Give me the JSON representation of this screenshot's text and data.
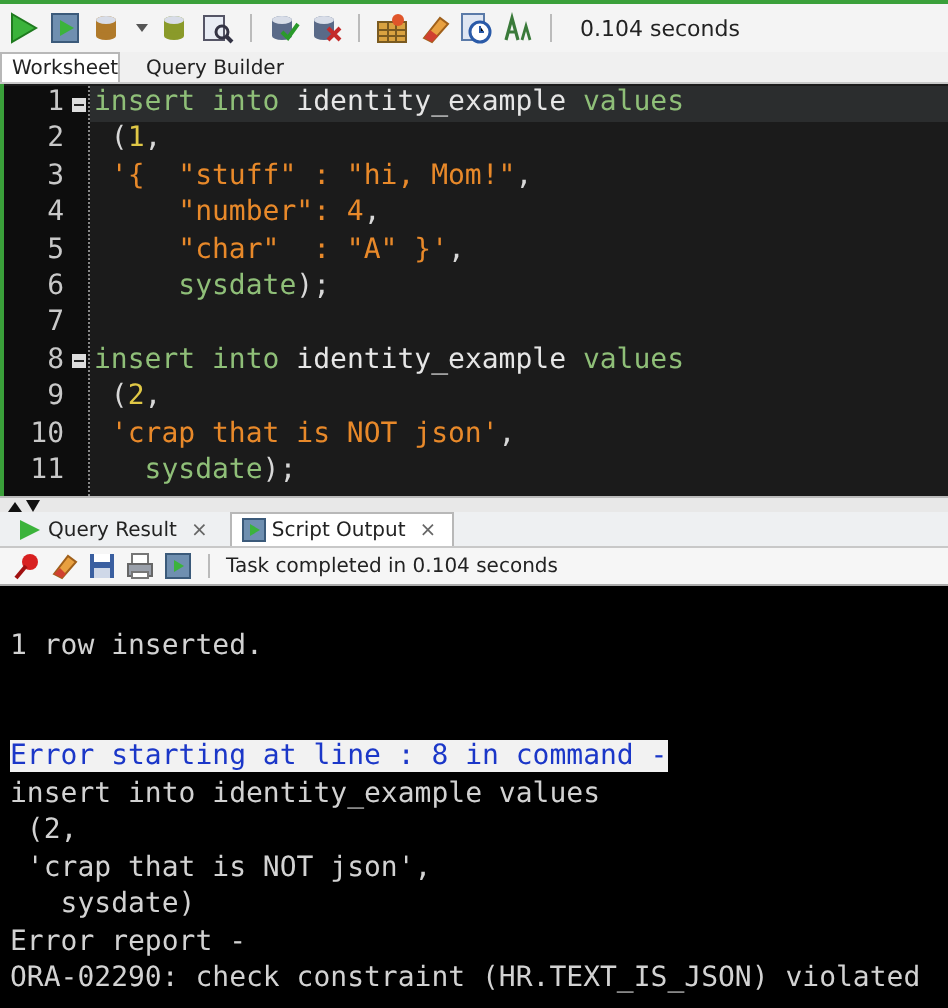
{
  "toolbar": {
    "elapsed": "0.104 seconds"
  },
  "editor_tabs": [
    {
      "label": "Worksheet",
      "selected": true
    },
    {
      "label": "Query Builder",
      "selected": false
    }
  ],
  "editor": {
    "lines": [
      {
        "number": "1",
        "foldable": true,
        "current": true,
        "tokens": [
          {
            "kind": "keyword",
            "text": "insert into "
          },
          {
            "kind": "ident",
            "text": "identity_example "
          },
          {
            "kind": "keyword",
            "text": "values"
          }
        ]
      },
      {
        "number": "2",
        "foldable": false,
        "current": false,
        "tokens": [
          {
            "kind": "punct",
            "text": " ("
          },
          {
            "kind": "number",
            "text": "1"
          },
          {
            "kind": "punct",
            "text": ","
          }
        ]
      },
      {
        "number": "3",
        "foldable": false,
        "current": false,
        "tokens": [
          {
            "kind": "string",
            "text": " '{  \"stuff\" : \"hi, Mom!\""
          },
          {
            "kind": "punct",
            "text": ","
          }
        ]
      },
      {
        "number": "4",
        "foldable": false,
        "current": false,
        "tokens": [
          {
            "kind": "string",
            "text": "     \"number\": 4"
          },
          {
            "kind": "punct",
            "text": ","
          }
        ]
      },
      {
        "number": "5",
        "foldable": false,
        "current": false,
        "tokens": [
          {
            "kind": "string",
            "text": "     \"char\"  : \"A\" }'"
          },
          {
            "kind": "punct",
            "text": ","
          }
        ]
      },
      {
        "number": "6",
        "foldable": false,
        "current": false,
        "tokens": [
          {
            "kind": "keyword",
            "text": "     sysdate"
          },
          {
            "kind": "punct",
            "text": ");"
          }
        ]
      },
      {
        "number": "7",
        "foldable": false,
        "current": false
      },
      {
        "number": "8",
        "foldable": true,
        "current": false,
        "tokens": [
          {
            "kind": "keyword",
            "text": "insert into "
          },
          {
            "kind": "ident",
            "text": "identity_example "
          },
          {
            "kind": "keyword",
            "text": "values"
          }
        ]
      },
      {
        "number": "9",
        "foldable": false,
        "current": false,
        "tokens": [
          {
            "kind": "punct",
            "text": " ("
          },
          {
            "kind": "number",
            "text": "2"
          },
          {
            "kind": "punct",
            "text": ","
          }
        ]
      },
      {
        "number": "10",
        "foldable": false,
        "current": false,
        "tokens": [
          {
            "kind": "string",
            "text": " 'crap that is NOT json'"
          },
          {
            "kind": "punct",
            "text": ","
          }
        ]
      },
      {
        "number": "11",
        "foldable": false,
        "current": false,
        "tokens": [
          {
            "kind": "keyword",
            "text": "   sysdate"
          },
          {
            "kind": "punct",
            "text": ");"
          }
        ]
      }
    ]
  },
  "result_tabs": [
    {
      "label": "Query Result",
      "selected": false,
      "close": "×"
    },
    {
      "label": "Script Output",
      "selected": true,
      "close": "×"
    }
  ],
  "output_toolbar": {
    "status": "Task completed in 0.104 seconds"
  },
  "output": {
    "lines": [
      {
        "kind": "blank"
      },
      {
        "kind": "text",
        "text": "1 row inserted."
      },
      {
        "kind": "blank"
      },
      {
        "kind": "blank"
      },
      {
        "kind": "error-header",
        "text": "Error starting at line : 8 in command -"
      },
      {
        "kind": "text",
        "text": "insert into identity_example values"
      },
      {
        "kind": "text",
        "text": " (2,"
      },
      {
        "kind": "text",
        "text": " 'crap that is NOT json',"
      },
      {
        "kind": "text",
        "text": "   sysdate)"
      },
      {
        "kind": "text",
        "text": "Error report -"
      },
      {
        "kind": "text",
        "text": "ORA-02290: check constraint (HR.TEXT_IS_JSON) violated"
      }
    ]
  }
}
